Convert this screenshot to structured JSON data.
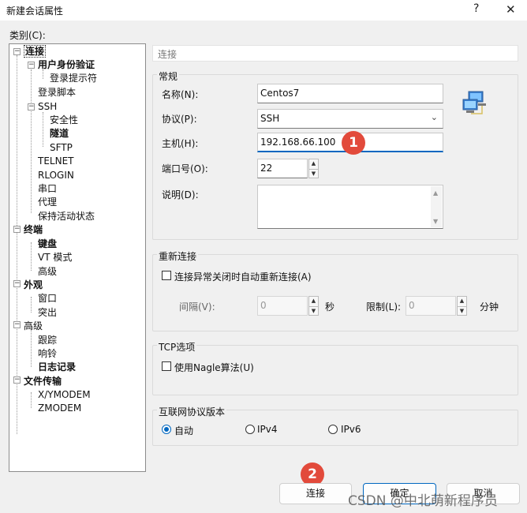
{
  "window": {
    "title": "新建会话属性",
    "help_label": "?",
    "close_label": "✕"
  },
  "category_label": "类别(C):",
  "tree": [
    {
      "label": "连接",
      "bold": true,
      "selected": true
    },
    {
      "label": "用户身份验证",
      "bold": true
    },
    {
      "label": "登录提示符"
    },
    {
      "label": "登录脚本"
    },
    {
      "label": "SSH"
    },
    {
      "label": "安全性"
    },
    {
      "label": "隧道",
      "bold": true
    },
    {
      "label": "SFTP"
    },
    {
      "label": "TELNET"
    },
    {
      "label": "RLOGIN"
    },
    {
      "label": "串口"
    },
    {
      "label": "代理"
    },
    {
      "label": "保持活动状态"
    },
    {
      "label": "终端",
      "bold": true
    },
    {
      "label": "键盘",
      "bold": true
    },
    {
      "label": "VT 模式"
    },
    {
      "label": "高级"
    },
    {
      "label": "外观",
      "bold": true
    },
    {
      "label": "窗口"
    },
    {
      "label": "突出"
    },
    {
      "label": "高级"
    },
    {
      "label": "跟踪"
    },
    {
      "label": "响铃"
    },
    {
      "label": "日志记录",
      "bold": true
    },
    {
      "label": "文件传输",
      "bold": true
    },
    {
      "label": "X/YMODEM"
    },
    {
      "label": "ZMODEM"
    }
  ],
  "section_header": "连接",
  "general": {
    "title": "常规",
    "name_label": "名称(N):",
    "name_value": "Centos7",
    "protocol_label": "协议(P):",
    "protocol_value": "SSH",
    "host_label": "主机(H):",
    "host_value": "192.168.66.100",
    "port_label": "端口号(O):",
    "port_value": "22",
    "desc_label": "说明(D):",
    "desc_value": ""
  },
  "reconnect": {
    "title": "重新连接",
    "checkbox_label": "连接异常关闭时自动重新连接(A)",
    "interval_label": "间隔(V):",
    "interval_value": "0",
    "interval_unit": "秒",
    "limit_label": "限制(L):",
    "limit_value": "0",
    "limit_unit": "分钟"
  },
  "tcp": {
    "title": "TCP选项",
    "checkbox_label": "使用Nagle算法(U)"
  },
  "ip": {
    "title": "互联网协议版本",
    "options": [
      {
        "label": "自动",
        "checked": true
      },
      {
        "label": "IPv4"
      },
      {
        "label": "IPv6"
      }
    ]
  },
  "badges": {
    "one": "1",
    "two": "2"
  },
  "buttons": {
    "connect": "连接",
    "ok": "确定",
    "cancel": "取消"
  },
  "watermark": "CSDN @中北萌新程序员",
  "icons": {
    "network": "network-computers-icon"
  }
}
